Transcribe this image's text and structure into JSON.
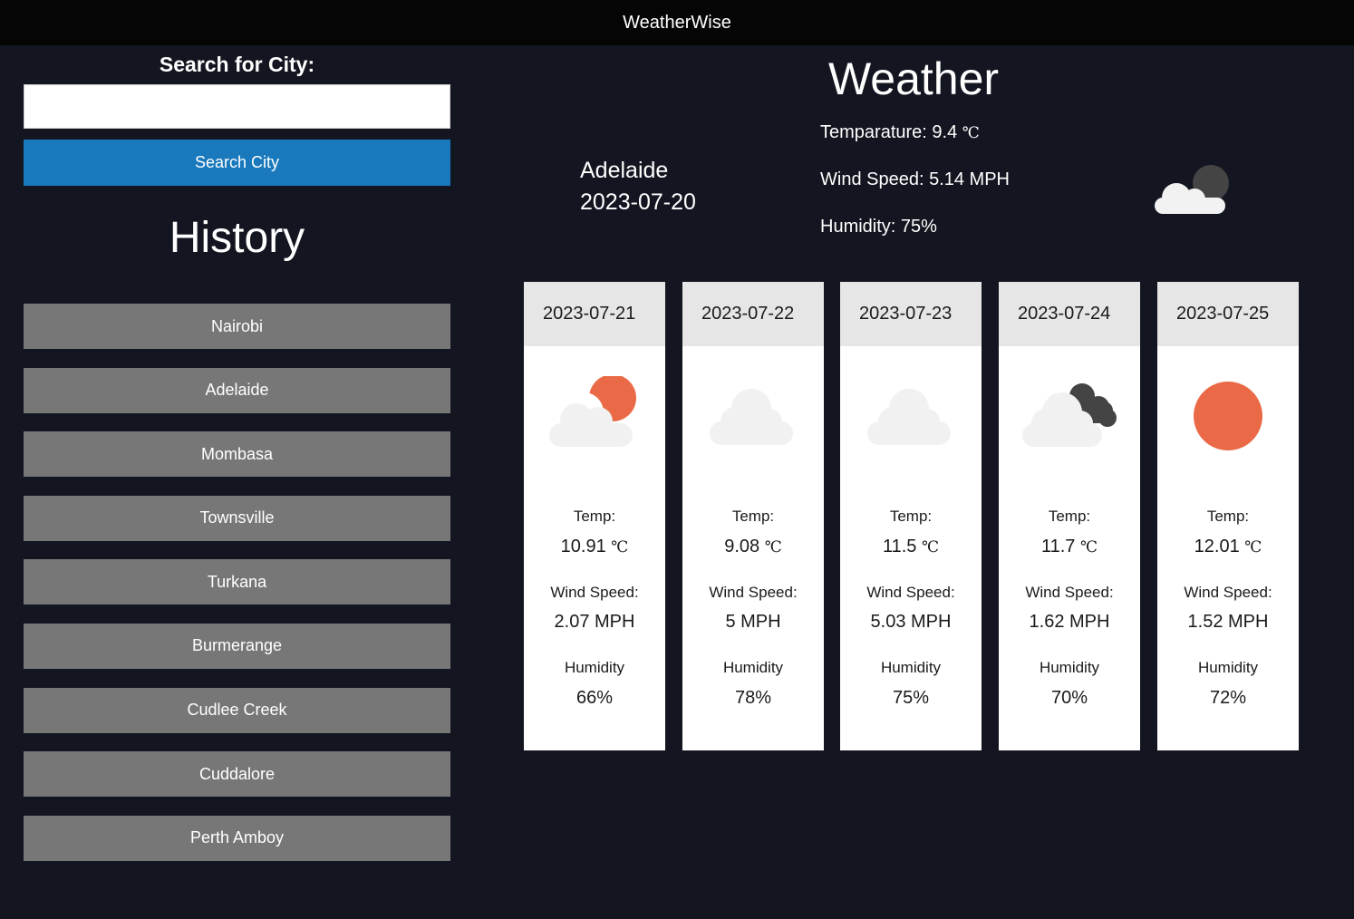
{
  "app": {
    "title": "WeatherWise"
  },
  "search": {
    "label": "Search for City:",
    "input_value": "",
    "placeholder": "",
    "button_label": "Search City"
  },
  "history": {
    "title": "History",
    "items": [
      "Nairobi",
      "Adelaide",
      "Mombasa",
      "Townsville",
      "Turkana",
      "Burmerange",
      "Cudlee Creek",
      "Cuddalore",
      "Perth Amboy"
    ]
  },
  "current": {
    "heading": "Weather",
    "city": "Adelaide",
    "date": "2023-07-20",
    "temp_label": "Temparature:",
    "temp_value": "9.4",
    "temp_unit": "℃",
    "wind_label": "Wind Speed:",
    "wind_value": "5.14 MPH",
    "humidity_label": "Humidity:",
    "humidity_value": "75%",
    "icon": "cloud-night-icon"
  },
  "forecast": [
    {
      "date": "2023-07-21",
      "icon": "partly-sunny-icon",
      "temp_label": "Temp:",
      "temp": "10.91",
      "unit": "℃",
      "wind_label": "Wind Speed:",
      "wind": "2.07 MPH",
      "humidity_label": "Humidity",
      "humidity": "66%"
    },
    {
      "date": "2023-07-22",
      "icon": "cloud-icon",
      "temp_label": "Temp:",
      "temp": "9.08",
      "unit": "℃",
      "wind_label": "Wind Speed:",
      "wind": "5 MPH",
      "humidity_label": "Humidity",
      "humidity": "78%"
    },
    {
      "date": "2023-07-23",
      "icon": "cloud-icon",
      "temp_label": "Temp:",
      "temp": "11.5",
      "unit": "℃",
      "wind_label": "Wind Speed:",
      "wind": "5.03 MPH",
      "humidity_label": "Humidity",
      "humidity": "75%"
    },
    {
      "date": "2023-07-24",
      "icon": "broken-clouds-icon",
      "temp_label": "Temp:",
      "temp": "11.7",
      "unit": "℃",
      "wind_label": "Wind Speed:",
      "wind": "1.62 MPH",
      "humidity_label": "Humidity",
      "humidity": "70%"
    },
    {
      "date": "2023-07-25",
      "icon": "sun-icon",
      "temp_label": "Temp:",
      "temp": "12.01",
      "unit": "℃",
      "wind_label": "Wind Speed:",
      "wind": "1.52 MPH",
      "humidity_label": "Humidity",
      "humidity": "72%"
    }
  ],
  "colors": {
    "background": "#131620",
    "topbar": "#050505",
    "accent": "#1979bc",
    "history_button": "#777777",
    "sun": "#ea6a47",
    "cloud_light": "#f1f1f1",
    "cloud_dark": "#444444"
  }
}
